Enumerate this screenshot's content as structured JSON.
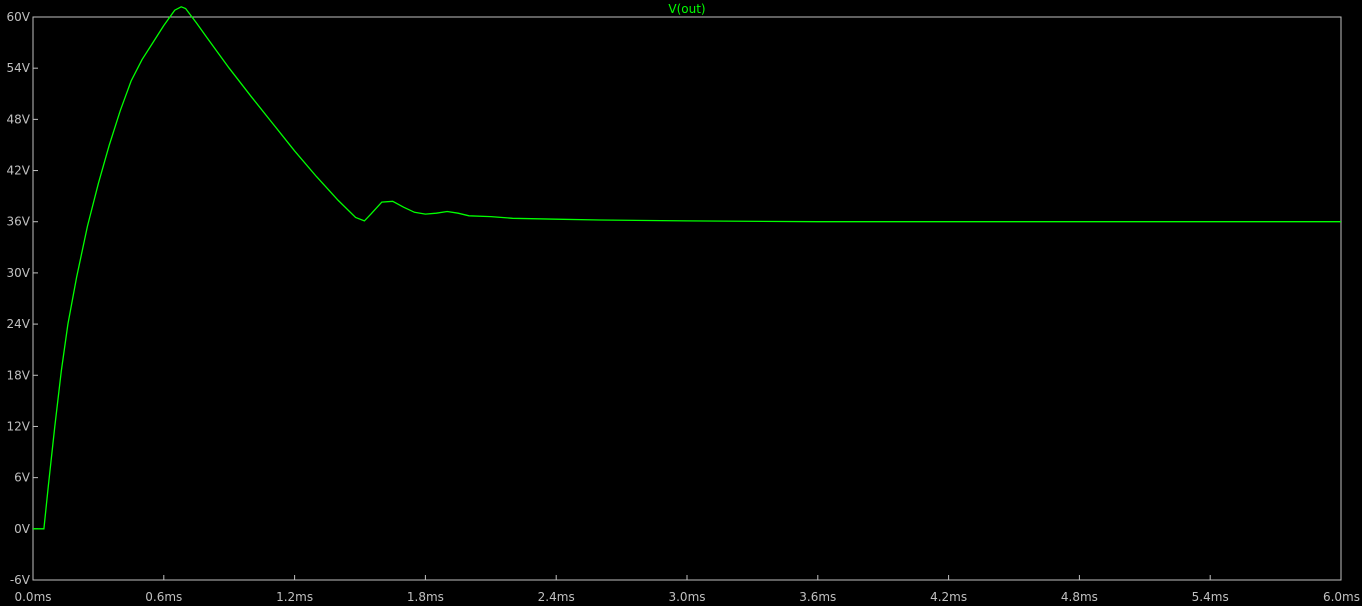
{
  "chart_data": {
    "type": "line",
    "title": "V(out)",
    "xlabel": "",
    "ylabel": "",
    "xlim": [
      0,
      6.0
    ],
    "ylim": [
      -6,
      60
    ],
    "x_ticks": [
      0,
      0.6,
      1.2,
      1.8,
      2.4,
      3.0,
      3.6,
      4.2,
      4.8,
      5.4,
      6.0
    ],
    "x_tick_labels": [
      "0.0ms",
      "0.6ms",
      "1.2ms",
      "1.8ms",
      "2.4ms",
      "3.0ms",
      "3.6ms",
      "4.2ms",
      "4.8ms",
      "5.4ms",
      "6.0ms"
    ],
    "y_ticks": [
      -6,
      0,
      6,
      12,
      18,
      24,
      30,
      36,
      42,
      48,
      54,
      60
    ],
    "y_tick_labels": [
      "-6V",
      "0V",
      "6V",
      "12V",
      "18V",
      "24V",
      "30V",
      "36V",
      "42V",
      "48V",
      "54V",
      "60V"
    ],
    "grid": false,
    "colors": {
      "background": "#000000",
      "axis": "#c0c0c0",
      "trace": "#00ff00"
    },
    "series": [
      {
        "name": "V(out)",
        "x": [
          0,
          0.03,
          0.05,
          0.07,
          0.1,
          0.13,
          0.16,
          0.2,
          0.25,
          0.3,
          0.35,
          0.4,
          0.45,
          0.5,
          0.55,
          0.6,
          0.65,
          0.68,
          0.7,
          0.75,
          0.8,
          0.9,
          1.0,
          1.1,
          1.2,
          1.3,
          1.4,
          1.48,
          1.52,
          1.55,
          1.6,
          1.65,
          1.7,
          1.75,
          1.8,
          1.85,
          1.9,
          1.95,
          2.0,
          2.1,
          2.2,
          2.4,
          2.6,
          3.0,
          3.6,
          4.2,
          4.8,
          5.4,
          6.0
        ],
        "y": [
          0,
          0,
          0,
          5,
          12,
          18.5,
          24,
          29.5,
          35.5,
          40.5,
          45,
          49,
          52.5,
          55,
          57,
          59,
          60.8,
          61.2,
          61,
          59.3,
          57.5,
          54,
          50.7,
          47.5,
          44.3,
          41.3,
          38.5,
          36.5,
          36.1,
          36.9,
          38.3,
          38.4,
          37.7,
          37.1,
          36.9,
          37.0,
          37.2,
          37.0,
          36.7,
          36.6,
          36.4,
          36.3,
          36.2,
          36.1,
          36.0,
          36.0,
          36.0,
          36.0,
          36.0
        ]
      }
    ]
  }
}
